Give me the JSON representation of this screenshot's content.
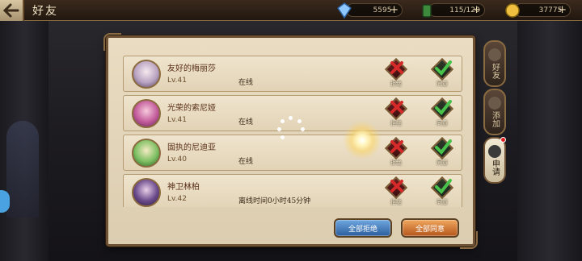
{
  "header": {
    "title": "好友",
    "resources": [
      {
        "name": "gems",
        "icon": "diamond-icon",
        "value": "5595"
      },
      {
        "name": "stamina",
        "icon": "stamina-icon",
        "value": "115/120"
      },
      {
        "name": "gold",
        "icon": "coin-icon",
        "value": "37775"
      }
    ]
  },
  "friend_requests": [
    {
      "name": "友好的梅丽莎",
      "level": "Lv.41",
      "status": "在线"
    },
    {
      "name": "光荣的索尼娅",
      "level": "Lv.41",
      "status": "在线"
    },
    {
      "name": "固执的尼迪亚",
      "level": "Lv.40",
      "status": "在线"
    },
    {
      "name": "神卫林柏",
      "level": "Lv.42",
      "status": "离线时间0小时45分钟"
    }
  ],
  "row_actions": {
    "reject": "拒绝",
    "accept": "同意"
  },
  "bottom_actions": {
    "reject_all": "全部拒绝",
    "accept_all": "全部同意"
  },
  "side_tabs": [
    {
      "label": "好友",
      "active": false
    },
    {
      "label": "添加",
      "active": false
    },
    {
      "label": "申请",
      "active": true,
      "badge": true
    }
  ],
  "colors": {
    "reject": "#a51f1f",
    "accept": "#39a83a",
    "accent": "#8a6a40"
  }
}
